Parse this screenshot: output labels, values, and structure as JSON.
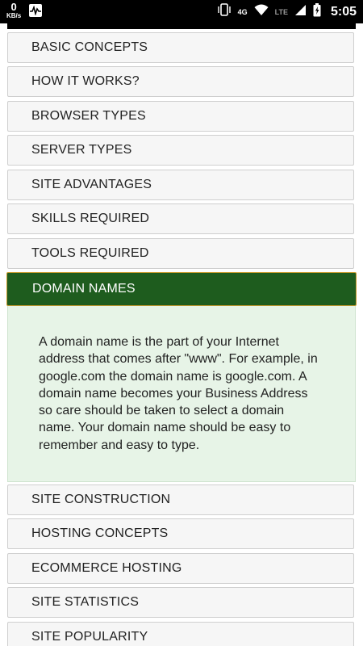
{
  "status_bar": {
    "speed_value": "0",
    "speed_unit": "KB/s",
    "network_4g": "4G",
    "network_lte": "LTE",
    "time": "5:05",
    "icons": [
      "activity-icon",
      "vibrate-icon",
      "wifi-icon",
      "signal-icon",
      "battery-icon"
    ]
  },
  "accordion": {
    "items_before": [
      {
        "label": "BASIC CONCEPTS"
      },
      {
        "label": "HOW IT WORKS?"
      },
      {
        "label": "BROWSER TYPES"
      },
      {
        "label": "SERVER TYPES"
      },
      {
        "label": "SITE ADVANTAGES"
      },
      {
        "label": "SKILLS REQUIRED"
      },
      {
        "label": "TOOLS REQUIRED"
      }
    ],
    "active": {
      "label": "DOMAIN NAMES",
      "content": "A domain name is the part of your Internet address that comes after \"www\". For example, in google.com the domain name is google.com. A domain name becomes your Business Address so care should be taken to select a domain name. Your domain name should be easy to remember and easy to type."
    },
    "items_after": [
      {
        "label": "SITE CONSTRUCTION"
      },
      {
        "label": "HOSTING CONCEPTS"
      },
      {
        "label": "ECOMMERCE HOSTING"
      },
      {
        "label": "SITE STATISTICS"
      },
      {
        "label": "SITE POPULARITY"
      }
    ]
  },
  "colors": {
    "active_header_bg": "#1e5c1e",
    "active_header_border": "#c79a2c",
    "panel_bg": "#e7f4e7",
    "item_bg": "#f6f6f6"
  }
}
